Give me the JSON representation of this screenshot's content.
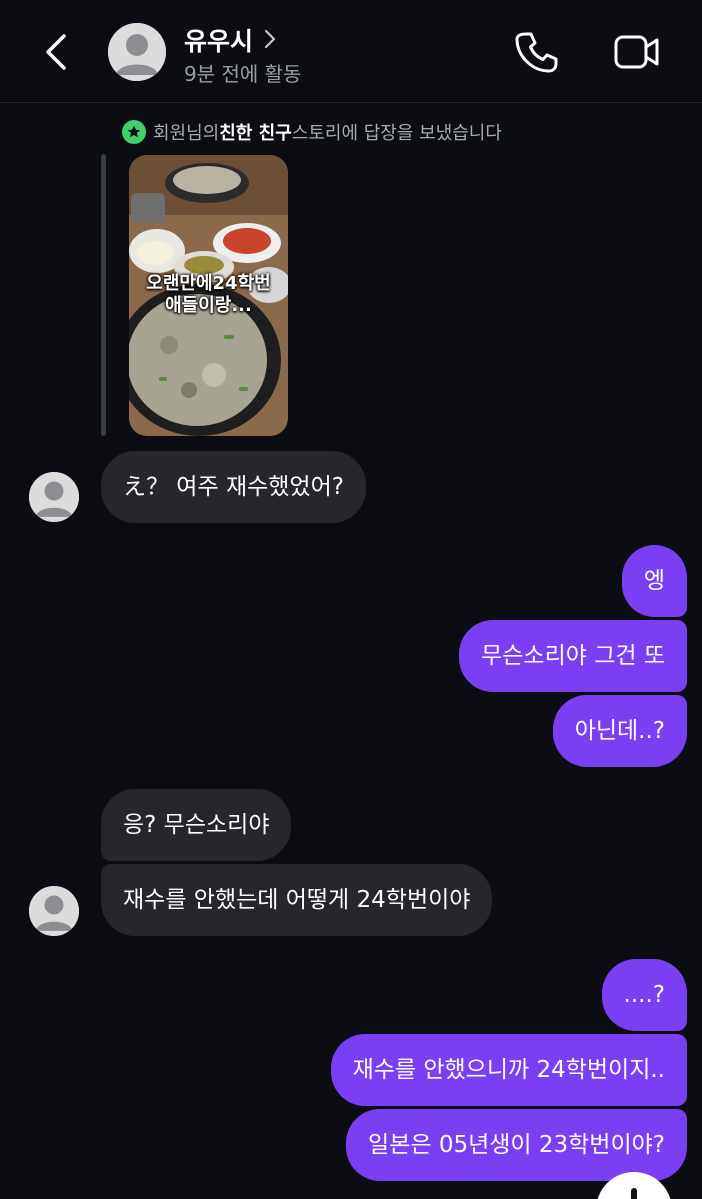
{
  "header": {
    "contact_name": "유우시",
    "status": "9분 전에 활동"
  },
  "story": {
    "note_prefix": "회원님의 ",
    "note_highlight": "친한 친구",
    "note_suffix": " 스토리에 답장을 보냈습니다",
    "caption_line1": "오랜만에24학번",
    "caption_line2": "애들이랑..."
  },
  "messages": [
    {
      "from": "them",
      "text": "え？ 여주 재수했었어?"
    },
    {
      "from": "me",
      "text": "엥"
    },
    {
      "from": "me",
      "text": "무슨소리야 그건 또"
    },
    {
      "from": "me",
      "text": "아닌데..?"
    },
    {
      "from": "them",
      "text": "응? 무슨소리야"
    },
    {
      "from": "them",
      "text": "재수를 안했는데 어떻게 24학번이야"
    },
    {
      "from": "me",
      "text": "....?"
    },
    {
      "from": "me",
      "text": "재수를 안했으니까 24학번이지.."
    },
    {
      "from": "me",
      "text": "일본은 05년생이 23학번이야?"
    }
  ],
  "colors": {
    "background": "#0b0d12",
    "incoming_bubble": "#25272d",
    "outgoing_bubble": "#7a3ff3",
    "close_friends": "#3fcf6d"
  }
}
